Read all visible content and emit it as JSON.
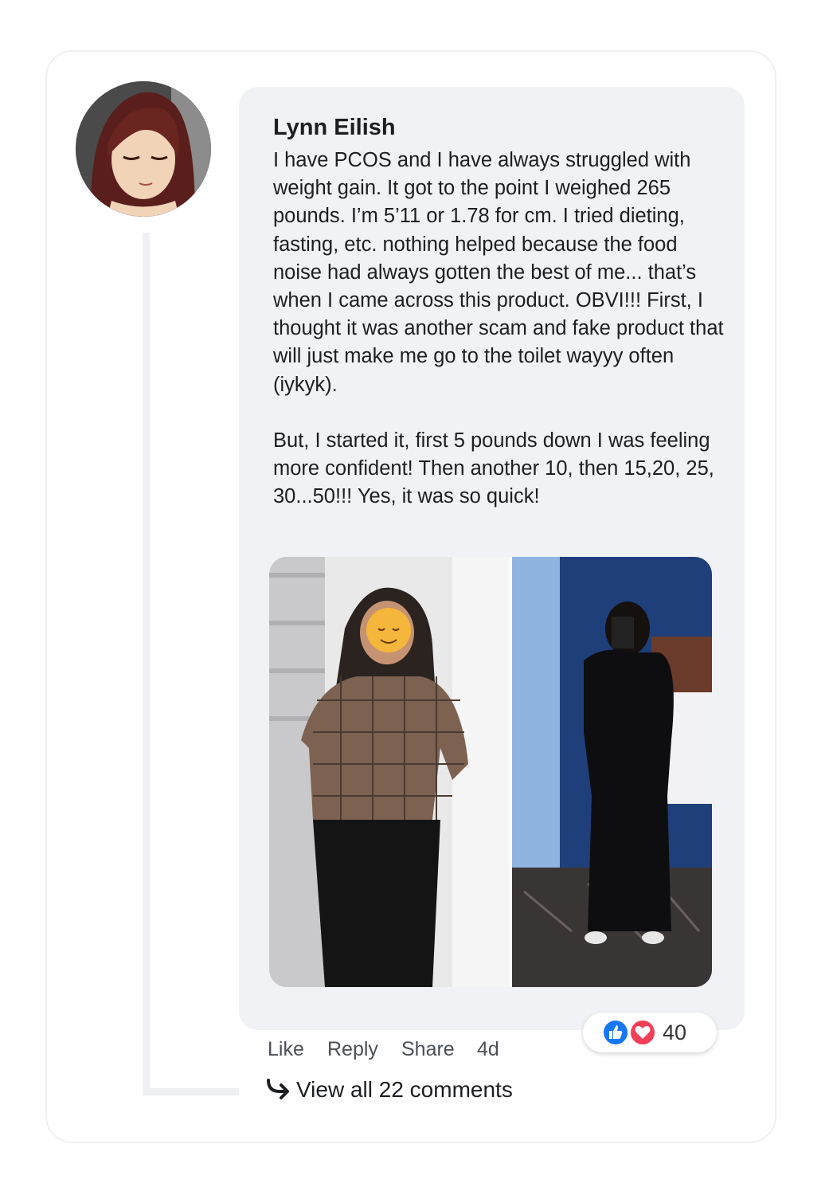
{
  "comment": {
    "author": "Lynn Eilish",
    "paragraphs": [
      "I have PCOS and I have always struggled with weight gain. It got to the point I weighed 265 pounds. I’m 5’11 or 1.78 for cm. I tried dieting, fasting, etc. nothing helped because the food noise had always gotten the best of me... that’s when I came across this product. OBVI!!! First, I thought it was another scam and fake product that will just make me go to the toilet wayyy often (iykyk).",
      "But, I started it, first 5 pounds down I was feeling more confident! Then another 10, then 15,20, 25, 30...50!!! Yes, it was so quick!"
    ],
    "reactions": {
      "icons": [
        "like-icon",
        "heart-icon"
      ],
      "count": "40"
    },
    "actions": {
      "like": "Like",
      "reply": "Reply",
      "share": "Share",
      "time": "4d"
    },
    "view_all": "View all 22 comments"
  },
  "colors": {
    "bubble": "#f0f2f5",
    "like_blue": "#1877f2",
    "heart_red": "#f33e58",
    "thread_line": "#eef0f3"
  }
}
